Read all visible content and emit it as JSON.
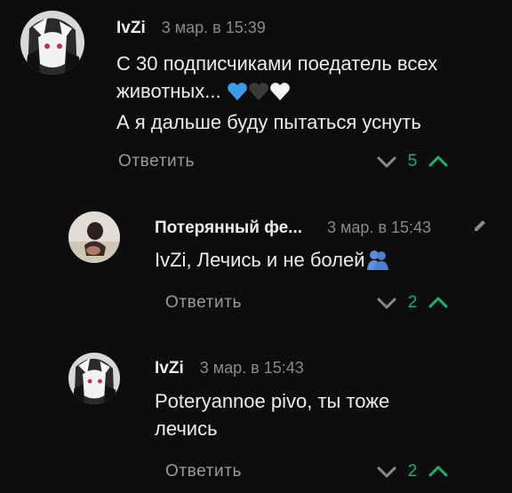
{
  "comments": [
    {
      "author": "IvZi",
      "time": "3 мар. в 15:39",
      "lines": [
        "С 30 подписчиками поедатель всех",
        "животных...",
        "А я дальше буду пытаться уснуть"
      ],
      "reply_label": "Ответить",
      "score": "5",
      "avatar_icon": "anime-avatar-icon",
      "emojis": [
        "blue-heart-icon",
        "black-heart-icon",
        "white-heart-icon"
      ]
    },
    {
      "author": "Потерянный фе...",
      "time": "3 мар. в 15:43",
      "lines": [
        "IvZi, Лечись и не болей"
      ],
      "reply_label": "Ответить",
      "score": "2",
      "avatar_icon": "photo-avatar-icon",
      "emojis": [
        "hugging-people-icon"
      ],
      "edited_icon": "pencil-icon"
    },
    {
      "author": "IvZi",
      "time": "3 мар. в 15:43",
      "lines": [
        "Poteryannoe pivo, ты тоже",
        "лечись"
      ],
      "reply_label": "Ответить",
      "score": "2",
      "avatar_icon": "anime-avatar-icon"
    }
  ],
  "colors": {
    "background": "#0d0d0d",
    "score_green": "#19b36a",
    "muted_text": "#8a8a8a"
  }
}
